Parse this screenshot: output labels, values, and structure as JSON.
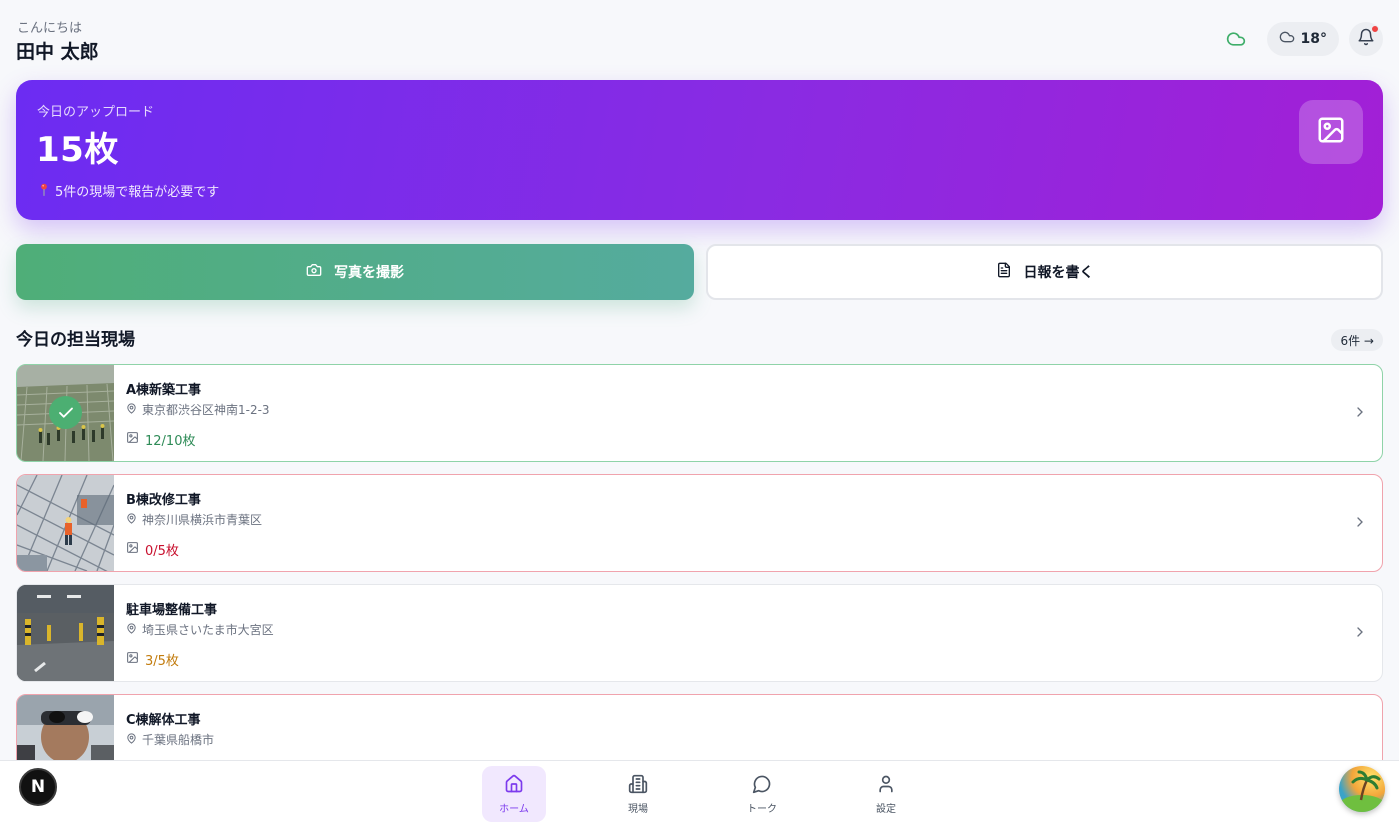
{
  "header": {
    "greeting": "こんにちは",
    "user_name": "田中 太郎",
    "weather_temp": "18°"
  },
  "hero": {
    "label": "今日のアップロード",
    "count": "15枚",
    "note": "5件の現場で報告が必要です"
  },
  "actions": {
    "take_photo_label": "写真を撮影",
    "write_report_label": "日報を書く"
  },
  "sites_section": {
    "title": "今日の担当現場",
    "count_label": "6件 →"
  },
  "sites": [
    {
      "name": "A棟新築工事",
      "address": "東京都渋谷区神南1-2-3",
      "photos": "12/10枚",
      "status": "complete"
    },
    {
      "name": "B棟改修工事",
      "address": "神奈川県横浜市青葉区",
      "photos": "0/5枚",
      "status": "missing"
    },
    {
      "name": "駐車場整備工事",
      "address": "埼玉県さいたま市大宮区",
      "photos": "3/5枚",
      "status": "partial"
    },
    {
      "name": "C棟解体工事",
      "address": "千葉県船橋市",
      "photos": "",
      "status": "missing"
    }
  ],
  "nav": {
    "home": "ホーム",
    "sites": "現場",
    "talk": "トーク",
    "settings": "設定"
  },
  "dev_badge": "N",
  "colors": {
    "accent": "#7c3aed",
    "hero_start": "#6c2cf2",
    "hero_end": "#a21fd6",
    "success": "#2e8b57",
    "danger": "#c8102e",
    "warning": "#c27c0e"
  }
}
